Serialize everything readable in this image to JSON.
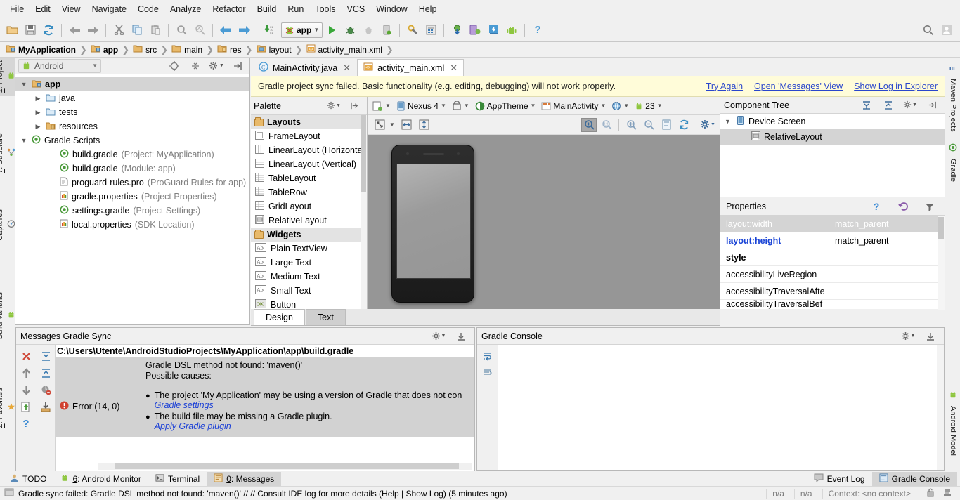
{
  "menubar": {
    "items": [
      {
        "label": "File",
        "mnemonic": "F"
      },
      {
        "label": "Edit",
        "mnemonic": "E"
      },
      {
        "label": "View",
        "mnemonic": "V"
      },
      {
        "label": "Navigate",
        "mnemonic": "N"
      },
      {
        "label": "Code",
        "mnemonic": "C"
      },
      {
        "label": "Analyze",
        "mnemonic": "z"
      },
      {
        "label": "Refactor",
        "mnemonic": "R"
      },
      {
        "label": "Build",
        "mnemonic": "B"
      },
      {
        "label": "Run",
        "mnemonic": "u"
      },
      {
        "label": "Tools",
        "mnemonic": "T"
      },
      {
        "label": "VCS",
        "mnemonic": "S"
      },
      {
        "label": "Window",
        "mnemonic": "W"
      },
      {
        "label": "Help",
        "mnemonic": "H"
      }
    ]
  },
  "toolbar": {
    "open_icon": "open-folder-icon",
    "save_icon": "save-all-icon",
    "sync_icon": "sync-icon",
    "undo_icon": "undo-arrow-icon",
    "redo_icon": "redo-arrow-icon",
    "cut_icon": "cut-scissors-icon",
    "copy_icon": "copy-icon",
    "paste_icon": "paste-icon",
    "find_icon": "find-icon",
    "replace_icon": "find-replace-icon",
    "back_icon": "navigate-back-icon",
    "forward_icon": "navigate-forward-icon",
    "compile_icon": "compile-icon",
    "run_config_label": "app",
    "run_icon": "run-play-icon",
    "debug_icon": "debug-bug-icon",
    "coverage_icon": "run-coverage-icon",
    "attach_debugger_icon": "attach-debugger-icon",
    "sdk_manager_icon": "sdk-manager-icon",
    "avd_manager_icon": "avd-manager-icon",
    "sync_gradle_icon": "sync-gradle-icon",
    "android_device_monitor_icon": "android-device-monitor-icon",
    "sdk_download_icon": "sdk-download-icon",
    "android_icon": "android-robot-icon",
    "help_icon": "help-question-icon",
    "search_icon": "search-everywhere-icon",
    "account_icon": "user-account-icon"
  },
  "breadcrumbs": [
    {
      "label": "MyApplication",
      "icon": "module-folder-icon",
      "bold": true
    },
    {
      "label": "app",
      "icon": "module-folder-icon",
      "bold": true
    },
    {
      "label": "src",
      "icon": "folder-icon",
      "bold": false
    },
    {
      "label": "main",
      "icon": "folder-icon",
      "bold": false
    },
    {
      "label": "res",
      "icon": "res-folder-icon",
      "bold": false
    },
    {
      "label": "layout",
      "icon": "layout-folder-icon",
      "bold": false
    },
    {
      "label": "activity_main.xml",
      "icon": "xml-file-icon",
      "bold": false
    }
  ],
  "left_tool_tabs": [
    {
      "label": "1: Project",
      "mnemonic": "1",
      "icon": "project-icon",
      "selected": true
    },
    {
      "label": "7: Structure",
      "mnemonic": "7",
      "icon": "structure-icon",
      "selected": false
    },
    {
      "label": "Captures",
      "mnemonic": "",
      "icon": "captures-icon",
      "selected": false
    },
    {
      "label": "Build Variants",
      "mnemonic": "",
      "icon": "android-robot-icon",
      "selected": false
    },
    {
      "label": "2: Favorites",
      "mnemonic": "2",
      "icon": "favorites-star-icon",
      "selected": false
    }
  ],
  "right_tool_tabs": [
    {
      "label": "Maven Projects",
      "icon": "maven-m-icon"
    },
    {
      "label": "Gradle",
      "icon": "gradle-elephant-icon"
    },
    {
      "label": "Android Model",
      "icon": "android-robot-icon"
    }
  ],
  "project_panel": {
    "title_combo": "Android",
    "header_icons": [
      "target-locate-icon",
      "collapse-all-icon",
      "settings-gear-icon",
      "hide-panel-icon"
    ],
    "tree": [
      {
        "label": "app",
        "sub": "",
        "indent": 0,
        "arrow": "▼",
        "icon": "module-folder-icon",
        "bold": true,
        "selected": true
      },
      {
        "label": "java",
        "sub": "",
        "indent": 1,
        "arrow": "▶",
        "icon": "folder-blue-icon",
        "bold": false,
        "selected": false
      },
      {
        "label": "tests",
        "sub": "",
        "indent": 1,
        "arrow": "▶",
        "icon": "folder-blue-icon",
        "bold": false,
        "selected": false
      },
      {
        "label": "resources",
        "sub": "",
        "indent": 1,
        "arrow": "▶",
        "icon": "res-folder-icon",
        "bold": false,
        "selected": false
      },
      {
        "label": "Gradle Scripts",
        "sub": "",
        "indent": 0,
        "arrow": "▼",
        "icon": "gradle-icon",
        "bold": false,
        "selected": false
      },
      {
        "label": "build.gradle",
        "sub": "(Project: MyApplication)",
        "indent": 2,
        "arrow": "",
        "icon": "gradle-icon",
        "bold": false,
        "selected": false
      },
      {
        "label": "build.gradle",
        "sub": "(Module: app)",
        "indent": 2,
        "arrow": "",
        "icon": "gradle-icon",
        "bold": false,
        "selected": false
      },
      {
        "label": "proguard-rules.pro",
        "sub": "(ProGuard Rules for app)",
        "indent": 2,
        "arrow": "",
        "icon": "text-file-icon",
        "bold": false,
        "selected": false
      },
      {
        "label": "gradle.properties",
        "sub": "(Project Properties)",
        "indent": 2,
        "arrow": "",
        "icon": "properties-file-icon",
        "bold": false,
        "selected": false
      },
      {
        "label": "settings.gradle",
        "sub": "(Project Settings)",
        "indent": 2,
        "arrow": "",
        "icon": "gradle-icon",
        "bold": false,
        "selected": false
      },
      {
        "label": "local.properties",
        "sub": "(SDK Location)",
        "indent": 2,
        "arrow": "",
        "icon": "properties-file-icon",
        "bold": false,
        "selected": false
      }
    ]
  },
  "editor_tabs": [
    {
      "label": "MainActivity.java",
      "icon": "java-class-icon",
      "active": false
    },
    {
      "label": "activity_main.xml",
      "icon": "xml-layout-icon",
      "active": true
    }
  ],
  "notification": {
    "message": "Gradle project sync failed. Basic functionality (e.g. editing, debugging) will not work properly.",
    "links": [
      "Try Again",
      "Open 'Messages' View",
      "Show Log in Explorer"
    ],
    "background": "#fffcd9",
    "link_color": "#2a46cc"
  },
  "palette": {
    "title": "Palette",
    "header_icons": [
      "settings-gear-icon",
      "hide-panel-icon"
    ],
    "groups": [
      {
        "name": "Layouts",
        "items": [
          {
            "label": "FrameLayout",
            "icon": "framelayout-icon"
          },
          {
            "label": "LinearLayout (Horizontal)",
            "icon": "linearlayout-horizontal-icon"
          },
          {
            "label": "LinearLayout (Vertical)",
            "icon": "linearlayout-vertical-icon"
          },
          {
            "label": "TableLayout",
            "icon": "tablelayout-icon"
          },
          {
            "label": "TableRow",
            "icon": "tablerow-icon"
          },
          {
            "label": "GridLayout",
            "icon": "gridlayout-icon"
          },
          {
            "label": "RelativeLayout",
            "icon": "relativelayout-icon"
          }
        ]
      },
      {
        "name": "Widgets",
        "items": [
          {
            "label": "Plain TextView",
            "icon": "textview-ab-icon"
          },
          {
            "label": "Large Text",
            "icon": "textview-ab-icon"
          },
          {
            "label": "Medium Text",
            "icon": "textview-ab-icon"
          },
          {
            "label": "Small Text",
            "icon": "textview-ab-icon"
          },
          {
            "label": "Button",
            "icon": "button-ok-icon"
          }
        ]
      }
    ]
  },
  "design_toolbar": {
    "device_config_icon": "device-config-icon",
    "device": "Nexus 4",
    "orientation_icon": "orientation-icon",
    "theme": "AppTheme",
    "theme_icon": "theme-contrast-icon",
    "activity": "MainActivity",
    "activity_icon": "activity-icon",
    "locale_icon": "locale-globe-icon",
    "api_level": "23",
    "api_icon": "android-api-icon"
  },
  "design_toolbar2": {
    "buttons": [
      {
        "name": "zoom-to-fit-icon",
        "pressed": false
      },
      {
        "name": "fit-width-icon",
        "pressed": false
      },
      {
        "name": "fit-height-icon",
        "pressed": false
      },
      {
        "name": "pan-zoom-icon",
        "pressed": true
      },
      {
        "name": "zoom-actual-size-icon",
        "pressed": false
      },
      {
        "name": "zoom-in-icon",
        "pressed": false
      },
      {
        "name": "zoom-out-icon",
        "pressed": false
      },
      {
        "name": "render-log-icon",
        "pressed": false
      },
      {
        "name": "refresh-render-icon",
        "pressed": false
      },
      {
        "name": "settings-gear-icon",
        "pressed": false
      }
    ]
  },
  "canvas": {
    "background_color": "#969696",
    "device_preview": "nexus-4-phone-frame"
  },
  "component_tree": {
    "title": "Component Tree",
    "header_icons": [
      "expand-all-icon",
      "collapse-all-icon",
      "settings-gear-icon",
      "hide-panel-icon"
    ],
    "nodes": [
      {
        "label": "Device Screen",
        "indent": 0,
        "arrow": "▼",
        "icon": "device-screen-icon",
        "selected": false
      },
      {
        "label": "RelativeLayout",
        "indent": 1,
        "arrow": "",
        "icon": "relativelayout-icon",
        "selected": true
      }
    ]
  },
  "properties": {
    "title": "Properties",
    "header_icons": [
      "help-question-icon",
      "restore-default-icon",
      "filter-funnel-icon"
    ],
    "rows": [
      {
        "key": "layout:width",
        "value": "match_parent",
        "style": "highlighted"
      },
      {
        "key": "layout:height",
        "value": "match_parent",
        "style": "blue-bold"
      },
      {
        "key": "style",
        "value": "",
        "style": "bold"
      },
      {
        "key": "accessibilityLiveRegion",
        "value": "",
        "style": "normal"
      },
      {
        "key": "accessibilityTraversalAfte",
        "value": "",
        "style": "normal"
      },
      {
        "key": "accessibilityTraversalBef",
        "value": "",
        "style": "clipped"
      }
    ]
  },
  "design_text_tabs": [
    {
      "label": "Design",
      "active": true
    },
    {
      "label": "Text",
      "active": false
    }
  ],
  "messages_panel": {
    "title": "Messages Gradle Sync",
    "header_icons": [
      "settings-gear-icon",
      "hide-panel-icon"
    ],
    "side_tools": [
      "close-x-icon",
      "expand-all-icon",
      "previous-up-arrow-icon",
      "collapse-all-icon",
      "next-down-arrow-icon",
      "filter-warnings-icon",
      "export-icon",
      "import-icon",
      "help-question-icon"
    ],
    "file_path": "C:\\Users\\Utente\\AndroidStudioProjects\\MyApplication\\app\\build.gradle",
    "error_label": "Error:(14, 0)",
    "error_icon": "error-circle-icon",
    "heading": "Gradle DSL method not found: 'maven()'",
    "subheading": "Possible causes:",
    "causes": [
      {
        "text": "The project 'My Application' may be using a version of Gradle that does not con",
        "link": "Gradle settings"
      },
      {
        "text": "The build file may be missing a Gradle plugin.",
        "link": "Apply Gradle plugin"
      }
    ]
  },
  "gradle_console": {
    "title": "Gradle Console",
    "header_icons": [
      "settings-gear-icon",
      "hide-panel-icon"
    ],
    "side_tools": [
      "soft-wrap-icon",
      "scroll-to-end-icon"
    ],
    "content": ""
  },
  "bottom_bar": {
    "left_tabs": [
      {
        "label": "TODO",
        "mnemonic": "",
        "icon": "todo-icon",
        "selected": false
      },
      {
        "label": "6: Android Monitor",
        "mnemonic": "6",
        "icon": "android-robot-icon",
        "selected": false
      },
      {
        "label": "Terminal",
        "mnemonic": "",
        "icon": "terminal-icon",
        "selected": false
      },
      {
        "label": "0: Messages",
        "mnemonic": "0",
        "icon": "messages-icon",
        "selected": true
      }
    ],
    "right_tabs": [
      {
        "label": "Event Log",
        "icon": "event-log-icon",
        "selected": false
      },
      {
        "label": "Gradle Console",
        "icon": "gradle-console-icon",
        "selected": true
      }
    ]
  },
  "status_bar": {
    "icon": "status-window-icon",
    "message": "Gradle sync failed: Gradle DSL method not found: 'maven()' // // Consult IDE log for more details (Help | Show Log) (5 minutes ago)",
    "cells": [
      "n/a",
      "n/a",
      "Context: <no context>"
    ],
    "lock_icon": "lock-icon",
    "memory_icon": "memory-indicator-icon"
  }
}
